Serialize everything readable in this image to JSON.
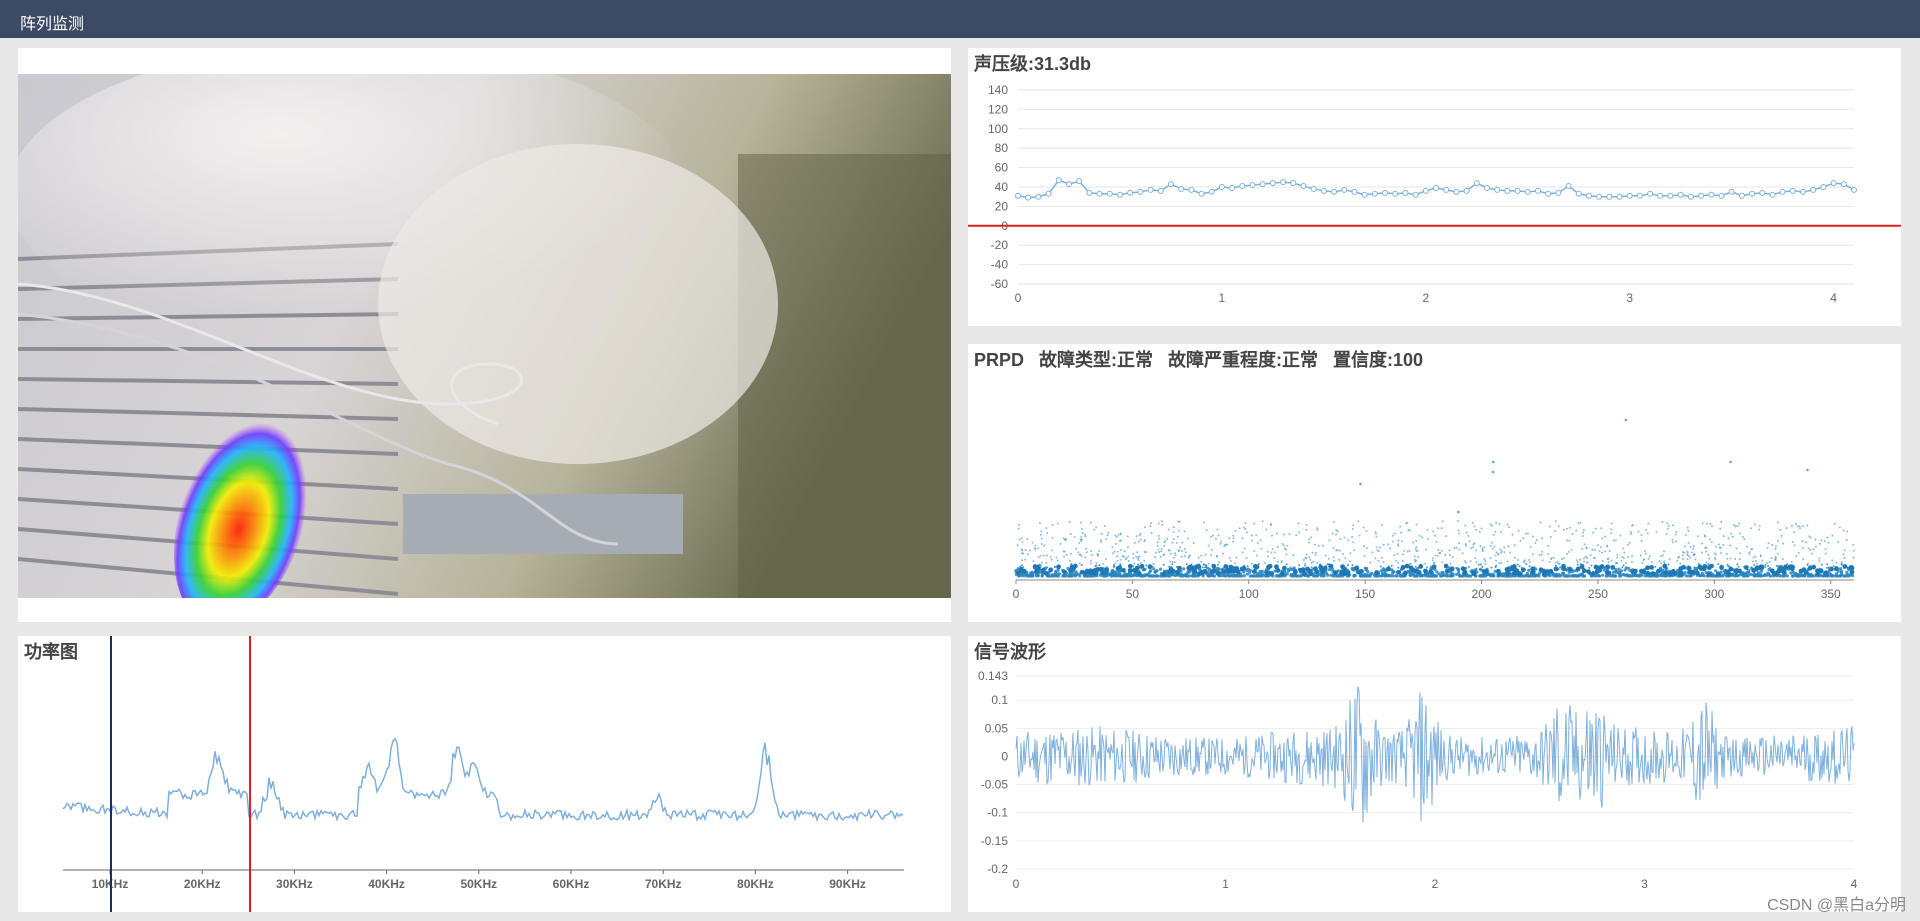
{
  "app": {
    "title": "阵列监测"
  },
  "watermark": "CSDN @黑白a分明",
  "camera": {
    "label": "camera-feed"
  },
  "spl": {
    "title": "声压级:31.3db",
    "ylim": [
      -60,
      140
    ],
    "yticks": [
      140,
      120,
      100,
      80,
      60,
      40,
      20,
      0,
      -20,
      -40,
      -60
    ],
    "xticks": [
      0,
      1,
      2,
      3,
      4
    ],
    "threshold": 0,
    "threshold_color": "#e02020",
    "line_color": "#7fb0dc"
  },
  "prpd": {
    "title": "PRPD   故障类型:正常   故障严重程度:正常   置信度:100",
    "xticks": [
      0,
      50,
      100,
      150,
      200,
      250,
      300,
      350
    ],
    "dot_color": "#2a86c0"
  },
  "power": {
    "title": "功率图",
    "xticks": [
      "10KHz",
      "20KHz",
      "30KHz",
      "40KHz",
      "50KHz",
      "60KHz",
      "70KHz",
      "80KHz",
      "90KHz"
    ],
    "cursor1_color": "#1c2c66",
    "cursor2_color": "#e02020",
    "line_color": "#7fb0dc"
  },
  "wave": {
    "title": "信号波形",
    "yticks": [
      "0.143",
      "0.1",
      "0.05",
      "0",
      "-0.05",
      "-0.1",
      "-0.15",
      "-0.2"
    ],
    "xticks": [
      0,
      1,
      2,
      3,
      4
    ],
    "fill_color": "#7fb0dc"
  },
  "chart_data": [
    {
      "type": "line",
      "title": "声压级:31.3db",
      "x": [
        0,
        0.05,
        0.1,
        0.15,
        0.2,
        0.25,
        0.3,
        0.35,
        0.4,
        0.45,
        0.5,
        0.55,
        0.6,
        0.65,
        0.7,
        0.75,
        0.8,
        0.85,
        0.9,
        0.95,
        1.0,
        1.05,
        1.1,
        1.15,
        1.2,
        1.25,
        1.3,
        1.35,
        1.4,
        1.45,
        1.5,
        1.55,
        1.6,
        1.65,
        1.7,
        1.75,
        1.8,
        1.85,
        1.9,
        1.95,
        2.0,
        2.05,
        2.1,
        2.15,
        2.2,
        2.25,
        2.3,
        2.35,
        2.4,
        2.45,
        2.5,
        2.55,
        2.6,
        2.65,
        2.7,
        2.75,
        2.8,
        2.85,
        2.9,
        2.95,
        3.0,
        3.05,
        3.1,
        3.15,
        3.2,
        3.25,
        3.3,
        3.35,
        3.4,
        3.45,
        3.5,
        3.55,
        3.6,
        3.65,
        3.7,
        3.75,
        3.8,
        3.85,
        3.9,
        3.95,
        4.0,
        4.05,
        4.1
      ],
      "values": [
        31,
        29,
        30,
        33,
        47,
        43,
        46,
        34,
        33,
        33,
        32,
        34,
        35,
        37,
        36,
        43,
        38,
        37,
        33,
        35,
        40,
        39,
        41,
        42,
        43,
        44,
        45,
        44,
        41,
        38,
        36,
        35,
        37,
        35,
        32,
        33,
        34,
        33,
        34,
        32,
        36,
        39,
        37,
        35,
        36,
        44,
        39,
        37,
        36,
        36,
        35,
        36,
        33,
        34,
        41,
        33,
        31,
        30,
        30,
        30,
        31,
        31,
        33,
        31,
        31,
        32,
        30,
        31,
        32,
        31,
        35,
        31,
        33,
        34,
        32,
        35,
        36,
        35,
        37,
        40,
        44,
        43,
        37,
        34,
        35,
        38,
        37
      ],
      "ylim": [
        -60,
        140
      ],
      "xlim": [
        0,
        4.1
      ]
    },
    {
      "type": "scatter",
      "title": "PRPD   故障类型:正常   故障严重程度:正常   置信度:100",
      "xlim": [
        0,
        360
      ],
      "note_points": [
        [
          205,
          118
        ],
        [
          262,
          160
        ],
        [
          307,
          118
        ],
        [
          340,
          110
        ],
        [
          148,
          96
        ],
        [
          190,
          68
        ],
        [
          205,
          108
        ]
      ]
    },
    {
      "type": "line",
      "title": "功率图",
      "categories": [
        "10KHz",
        "20KHz",
        "30KHz",
        "40KHz",
        "50KHz",
        "60KHz",
        "70KHz",
        "80KHz",
        "90KHz"
      ],
      "values": [
        38,
        42,
        36,
        52,
        70,
        32,
        36,
        40,
        35
      ]
    },
    {
      "type": "area",
      "title": "信号波形",
      "ylim": [
        -0.2,
        0.143
      ],
      "xlim": [
        0,
        4
      ]
    }
  ]
}
